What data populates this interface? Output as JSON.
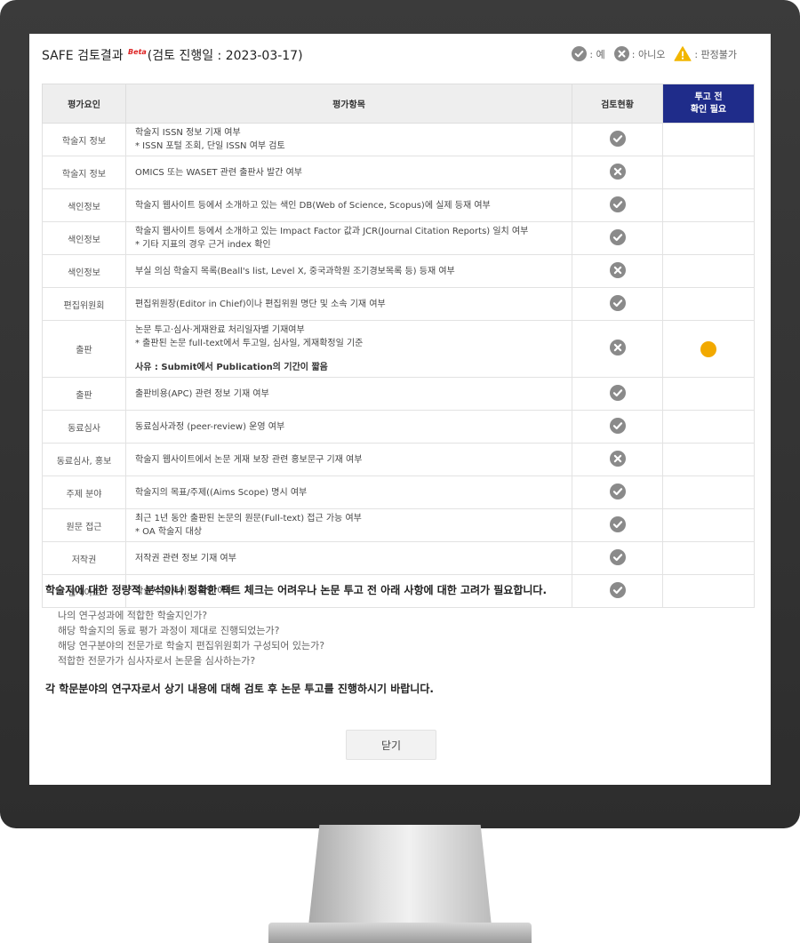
{
  "header": {
    "title_main": "SAFE 검토결과",
    "beta_badge": "Beta",
    "title_date": "(검토 진행일 : 2023-03-17)"
  },
  "legend": [
    {
      "icon": "check-circle-icon",
      "label": ": 예"
    },
    {
      "icon": "x-circle-icon",
      "label": ": 아니오"
    },
    {
      "icon": "warning-triangle-icon",
      "label": ": 판정불가"
    }
  ],
  "colors": {
    "check": "#8a8a8a",
    "warning": "#f2b600",
    "pending_dot": "#f2a900",
    "header_highlight": "#1f2c8a"
  },
  "table": {
    "headers": {
      "factor": "평가요인",
      "item": "평가항목",
      "status": "검토현황",
      "confirm_line1": "투고 전",
      "confirm_line2": "확인 필요"
    },
    "rows": [
      {
        "factor": "학술지 정보",
        "item": "학술지 ISSN 정보 기재 여부",
        "sub": "* ISSN 포털 조회, 단일 ISSN 여부 검토",
        "status": "check",
        "confirm": false
      },
      {
        "factor": "학술지 정보",
        "item": "OMICS 또는 WASET 관련 출판사 발간 여부",
        "status": "x",
        "confirm": false
      },
      {
        "factor": "색인정보",
        "item": "학술지 웹사이트 등에서 소개하고 있는 색인 DB(Web of Science, Scopus)에 실제 등재 여부",
        "status": "check",
        "confirm": false
      },
      {
        "factor": "색인정보",
        "item": "학술지 웹사이트 등에서 소개하고 있는 Impact Factor 값과 JCR(Journal Citation Reports) 일치 여부",
        "sub": "* 기타 지표의 경우 근거 index 확인",
        "status": "check",
        "confirm": false
      },
      {
        "factor": "색인정보",
        "item": "부실 의심 학술지 목록(Beall's list, Level X, 중국과학원 조기경보목록 등) 등재 여부",
        "status": "x",
        "confirm": false
      },
      {
        "factor": "편집위원회",
        "item": "편집위원장(Editor in Chief)이나 편집위원 명단 및 소속 기재 여부",
        "status": "check",
        "confirm": false
      },
      {
        "factor": "출판",
        "item": "논문 투고·심사·게재완료 처리일자별 기재여부",
        "sub": "* 출판된 논문 full-text에서 투고일, 심사일, 게재확정일 기준",
        "reason": "사유 : Submit에서 Publication의 기간이 짧음",
        "status": "x",
        "confirm": true
      },
      {
        "factor": "출판",
        "item": "출판비용(APC) 관련 정보 기재 여부",
        "status": "check",
        "confirm": false
      },
      {
        "factor": "동료심사",
        "item": "동료심사과정 (peer-review) 운영 여부",
        "status": "check",
        "confirm": false
      },
      {
        "factor": "동료심사, 홍보",
        "item": "학술지 웹사이트에서 논문 게재 보장 관련 홍보문구 기재 여부",
        "status": "x",
        "confirm": false
      },
      {
        "factor": "주제 분야",
        "item": "학술지의 목표/주제((Aims Scope) 명시 여부",
        "status": "check",
        "confirm": false
      },
      {
        "factor": "원문 접근",
        "item": "최근 1년 동안 출판된 논문의 원문(Full-text) 접근 가능 여부",
        "sub": "* OA 학술지 대상",
        "status": "check",
        "confirm": false
      },
      {
        "factor": "저작권",
        "item": "저작권 관련 정보 기재 여부",
        "status": "check",
        "confirm": false
      },
      {
        "factor": "웹사이트",
        "item": "학술지 웹사이트 운영 여부",
        "status": "check",
        "confirm": false
      }
    ]
  },
  "notice": "학술지에 대한 정량적 분석이나 정확한 팩트 체크는 어려우나 논문 투고 전 아래 사항에 대한 고려가 필요합니다.",
  "questions": [
    "나의 연구성과에 적합한 학술지인가?",
    "해당 학술지의 동료 평가 과정이 제대로 진행되었는가?",
    "해당 연구분야의 전문가로 학술지 편집위원회가 구성되어 있는가?",
    "적합한 전문가가 심사자로서 논문을 심사하는가?"
  ],
  "closing": "각 학문분야의 연구자로서 상기 내용에 대해 검토 후 논문 투고를 진행하시기 바랍니다.",
  "close_button": "닫기"
}
